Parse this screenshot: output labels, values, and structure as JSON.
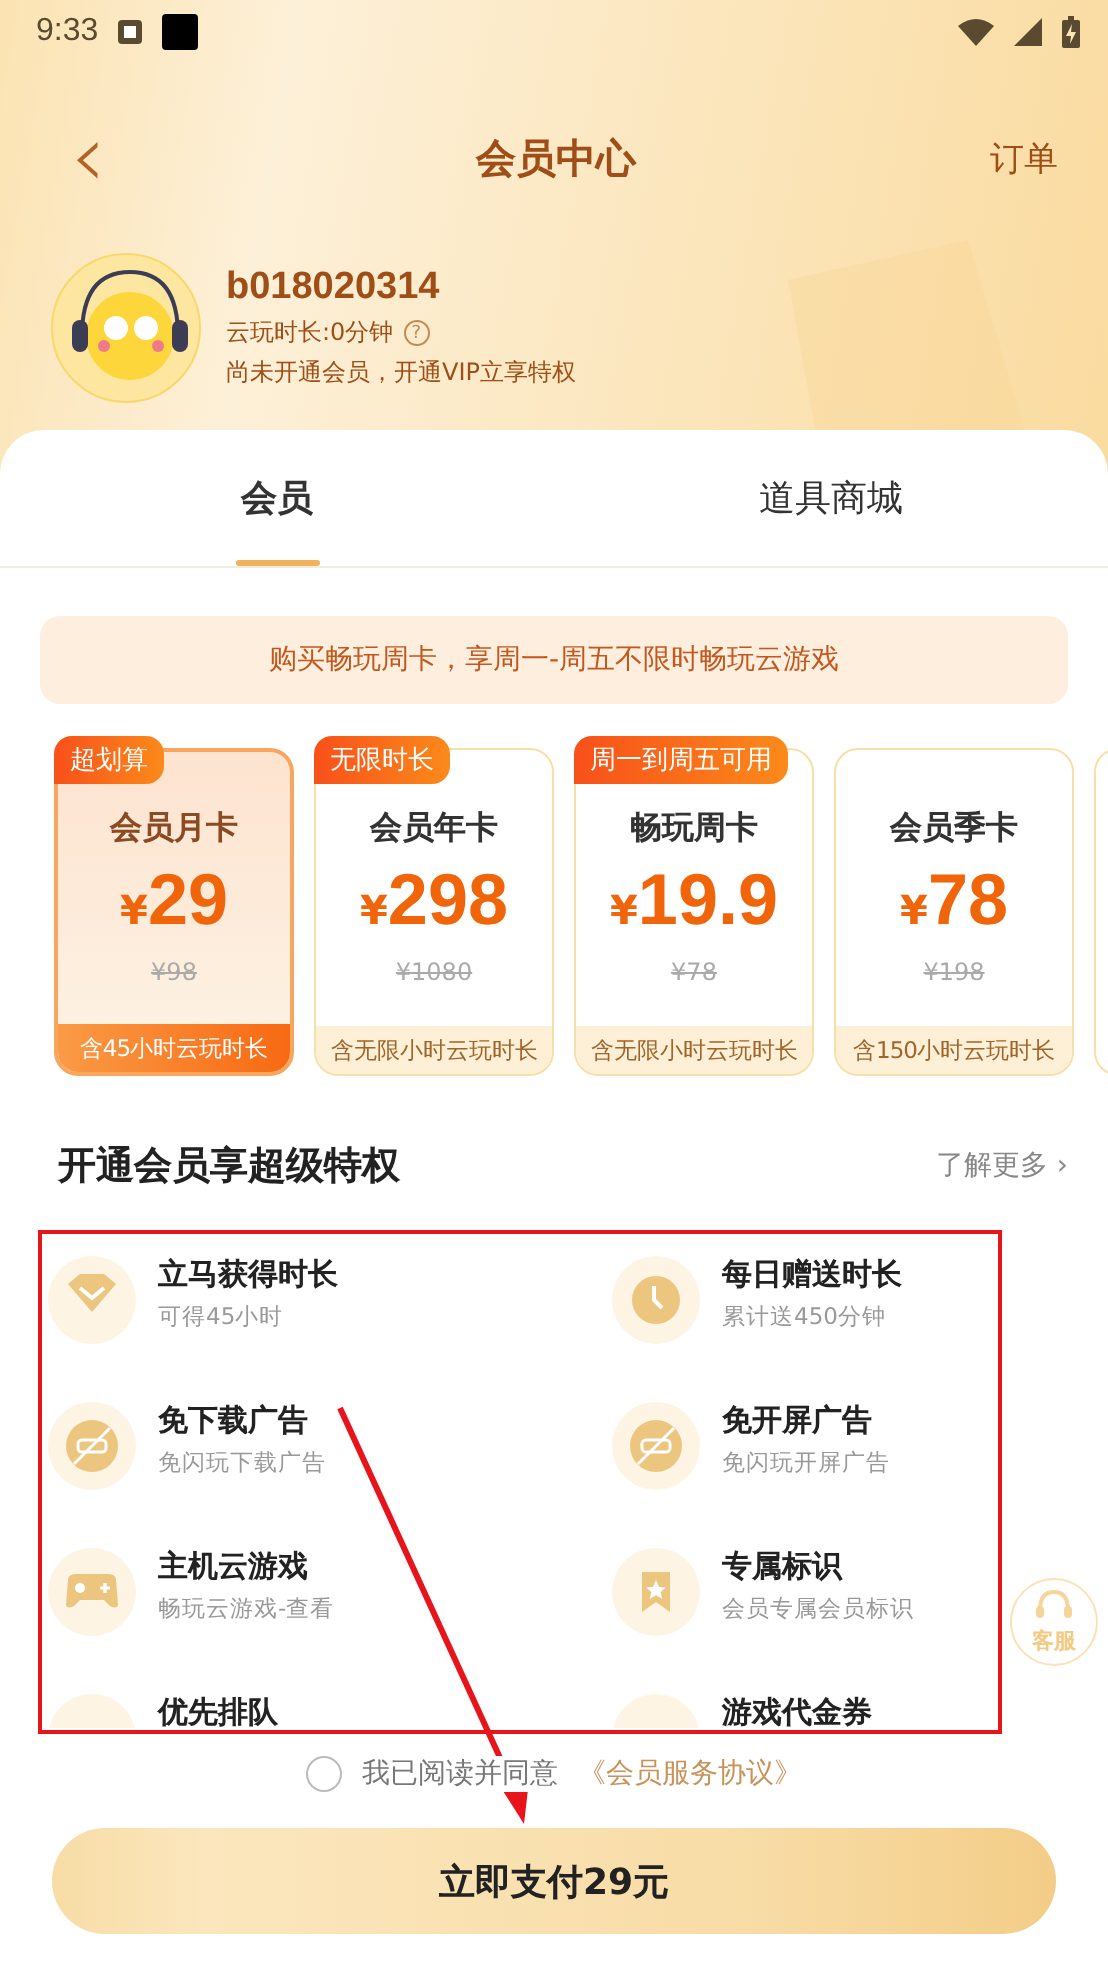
{
  "status_bar": {
    "time": "9:33"
  },
  "nav": {
    "back": "‹",
    "title": "会员中心",
    "orders": "订单"
  },
  "profile": {
    "username": "b018020314",
    "cloud_time": "云玩时长:0分钟",
    "help": "?",
    "notice": "尚未开通会员，开通VIP立享特权"
  },
  "tabs": [
    {
      "label": "会员",
      "selected": true
    },
    {
      "label": "道具商城",
      "selected": false
    }
  ],
  "banner": "购买畅玩周卡，享周一-周五不限时畅玩云游戏",
  "plans": [
    {
      "tag": "超划算",
      "name": "会员月卡",
      "currency": "¥",
      "price": "29",
      "original": "¥98",
      "included": "含45小时云玩时长",
      "selected": true
    },
    {
      "tag": "无限时长",
      "name": "会员年卡",
      "currency": "¥",
      "price": "298",
      "original": "¥1080",
      "included": "含无限小时云玩时长",
      "selected": false
    },
    {
      "tag": "周一到周五可用",
      "name": "畅玩周卡",
      "currency": "¥",
      "price": "19.9",
      "original": "¥78",
      "included": "含无限小时云玩时长",
      "selected": false
    },
    {
      "name": "会员季卡",
      "currency": "¥",
      "price": "78",
      "original": "¥198",
      "included": "含150小时云玩时长",
      "selected": false
    }
  ],
  "benefits_section": {
    "title": "开通会员享超级特权",
    "more": "了解更多",
    "more_arrow": "›"
  },
  "benefits": [
    {
      "title": "立马获得时长",
      "desc": "可得45小时"
    },
    {
      "title": "每日赠送时长",
      "desc": "累计送450分钟"
    },
    {
      "title": "免下载广告",
      "desc": "免闪玩下载广告"
    },
    {
      "title": "免开屏广告",
      "desc": "免闪玩开屏广告"
    },
    {
      "title": "主机云游戏",
      "desc": "畅玩云游戏-查看"
    },
    {
      "title": "专属标识",
      "desc": "会员专属会员标识"
    },
    {
      "title": "优先排队"
    },
    {
      "title": "游戏代金券"
    }
  ],
  "support": {
    "label": "客服"
  },
  "agreement": {
    "checked": false,
    "text": "我已阅读并同意",
    "link": "《会员服务协议》"
  },
  "pay_button": "立即支付29元",
  "annotations": {
    "highlight_box": true,
    "arrow": true
  }
}
